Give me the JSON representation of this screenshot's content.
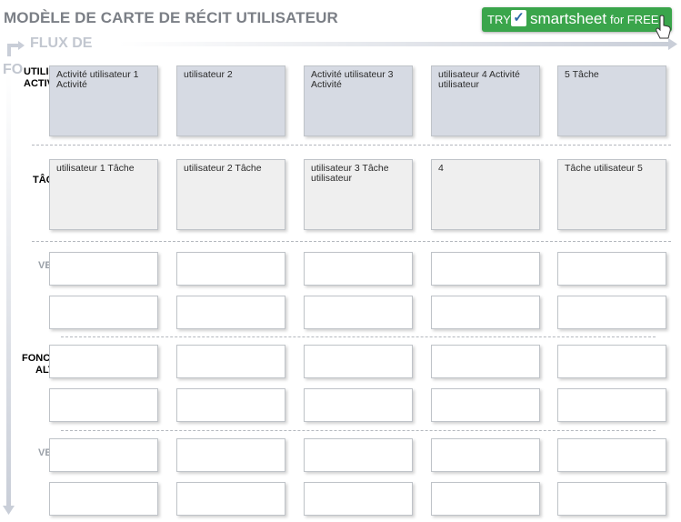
{
  "header": {
    "title": "MODÈLE DE CARTE DE RÉCIT UTILISATEUR"
  },
  "promo": {
    "try": "TRY",
    "brand": "smartsheet",
    "free": "for FREE",
    "colors": {
      "background": "#3aa54b",
      "check": "#2f6aa8"
    }
  },
  "flow": {
    "label_line1": "FLUX DE",
    "label_line2": "FO"
  },
  "rows": {
    "activities_label_line1": "UTILISATEUR",
    "activities_label_line2": "ACTIVITÉS",
    "tasks_label": "TÂCHES",
    "release_label_1": "VE",
    "functions_label_line1": "FONC",
    "functions_label_line2": "ALT",
    "release_label_2": "VE"
  },
  "activities": [
    "Activité utilisateur 1 Activité",
    "utilisateur 2",
    "Activité utilisateur 3 Activité",
    "utilisateur 4 Activité utilisateur",
    "5 Tâche"
  ],
  "tasks": [
    "utilisateur 1 Tâche",
    "utilisateur 2 Tâche",
    "utilisateur 3 Tâche utilisateur",
    "4",
    "Tâche utilisateur 5"
  ],
  "colors": {
    "activity_card": "#d6dae3",
    "task_card": "#efefef",
    "story_card": "#ffffff",
    "title": "#7b7f86",
    "flow_label": "#c2c7d0"
  }
}
